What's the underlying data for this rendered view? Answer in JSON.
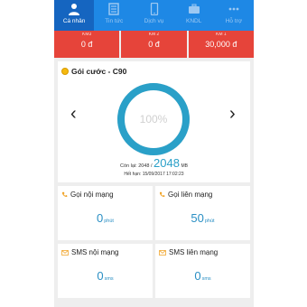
{
  "tabbar": {
    "tabs": [
      {
        "label": "Cá nhân",
        "icon": "person-icon",
        "active": true
      },
      {
        "label": "Tin tức",
        "icon": "news-icon",
        "active": false
      },
      {
        "label": "Dịch vụ",
        "icon": "phone-device-icon",
        "active": false
      },
      {
        "label": "KNDL",
        "icon": "briefcase-icon",
        "active": false
      },
      {
        "label": "Hỗ trợ",
        "icon": "more-icon",
        "active": false
      }
    ]
  },
  "accounts": [
    {
      "label": "KM3",
      "value": "0 đ"
    },
    {
      "label": "KM 2",
      "value": "0 đ"
    },
    {
      "label": "KM 1",
      "value": "30,000 đ"
    }
  ],
  "package": {
    "title": "Gói cước - C90",
    "percent_label": "100%",
    "percent": 100,
    "remaining_label": "Còn lại: 2048 /",
    "remaining_big": "2048",
    "remaining_unit": "MB",
    "expiry": "Hết hạn: 15/09/2017 17:02:23",
    "prev_label": "‹",
    "next_label": "›"
  },
  "cards": [
    {
      "title": "Gọi nội mạng",
      "value": "0",
      "unit": "phút",
      "icon": "phone-icon"
    },
    {
      "title": "Gọi liên mạng",
      "value": "50",
      "unit": "phút",
      "icon": "phone-icon"
    },
    {
      "title": "SMS nội mạng",
      "value": "0",
      "unit": "sms",
      "icon": "mail-icon"
    },
    {
      "title": "SMS liên mạng",
      "value": "0",
      "unit": "sms",
      "icon": "mail-icon"
    }
  ],
  "colors": {
    "tabbar": "#1e88e5",
    "tab_active": "#1565c0",
    "account_bar": "#e6443a",
    "ring": "#2aa0c8",
    "value": "#2a8fc4"
  }
}
